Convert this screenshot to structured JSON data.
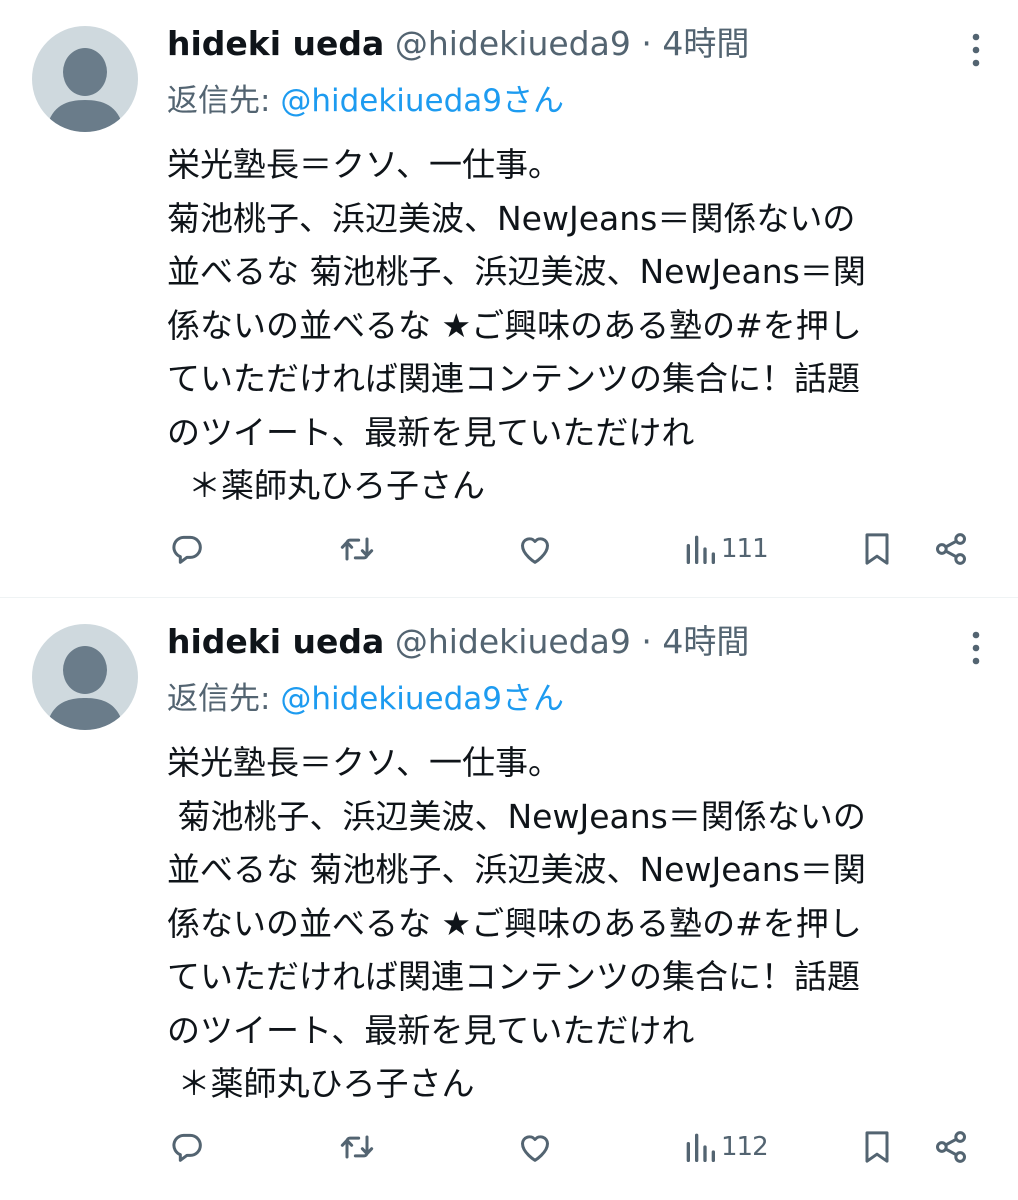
{
  "tweets": [
    {
      "author": {
        "name": "hideki ueda",
        "handle": "@hidekiueda9"
      },
      "dot": "·",
      "time": "4時間",
      "reply_prefix": "返信先: ",
      "reply_to": "@hidekiueda9さん",
      "lines": [
        "栄光塾長＝クソ、一仕事。",
        "菊池桃子、浜辺美波、NewJeans＝関係ないの",
        "並べるな 菊池桃子、浜辺美波、NewJeans＝関",
        "係ないの並べるな ★ご興味のある塾の#を押し",
        "ていただければ関連コンテンツの集合に！話題",
        "のツイート、最新を見ていただけれ",
        "  ＊薬師丸ひろ子さん"
      ],
      "views": "111",
      "icons": [
        "more-icon",
        "reply-icon",
        "retweet-icon",
        "like-icon",
        "views-icon",
        "bookmark-icon",
        "share-icon"
      ]
    },
    {
      "author": {
        "name": "hideki ueda",
        "handle": "@hidekiueda9"
      },
      "dot": "·",
      "time": "4時間",
      "reply_prefix": "返信先: ",
      "reply_to": "@hidekiueda9さん",
      "lines": [
        "栄光塾長＝クソ、一仕事。",
        " 菊池桃子、浜辺美波、NewJeans＝関係ないの",
        "並べるな 菊池桃子、浜辺美波、NewJeans＝関",
        "係ないの並べるな ★ご興味のある塾の#を押し",
        "ていただければ関連コンテンツの集合に！話題",
        "のツイート、最新を見ていただけれ",
        " ＊薬師丸ひろ子さん"
      ],
      "views": "112",
      "icons": [
        "more-icon",
        "reply-icon",
        "retweet-icon",
        "like-icon",
        "views-icon",
        "bookmark-icon",
        "share-icon"
      ]
    }
  ],
  "colors": {
    "text": "#0f1419",
    "secondary": "#536471",
    "link": "#1d9bf0",
    "avatar_bg": "#cfd9de",
    "avatar_fg": "#6a7c8a"
  }
}
